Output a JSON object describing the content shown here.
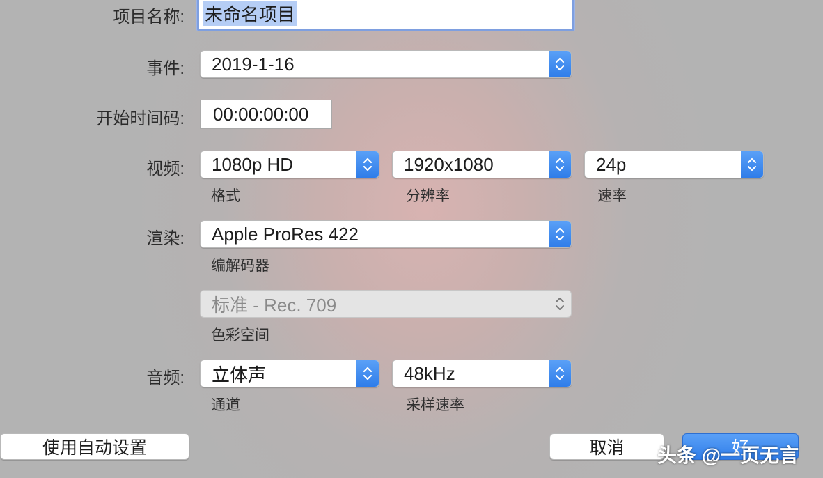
{
  "project_name": {
    "label": "项目名称:",
    "value": "未命名项目"
  },
  "event": {
    "label": "事件:",
    "value": "2019-1-16"
  },
  "timecode": {
    "label": "开始时间码:",
    "value": "00:00:00:00"
  },
  "video": {
    "label": "视频:",
    "format": {
      "value": "1080p HD",
      "caption": "格式"
    },
    "resolution": {
      "value": "1920x1080",
      "caption": "分辨率"
    },
    "rate": {
      "value": "24p",
      "caption": "速率"
    }
  },
  "render": {
    "label": "渲染:",
    "codec": {
      "value": "Apple ProRes 422",
      "caption": "编解码器"
    },
    "color_space": {
      "value": "标准 - Rec. 709",
      "caption": "色彩空间"
    }
  },
  "audio": {
    "label": "音频:",
    "channels": {
      "value": "立体声",
      "caption": "通道"
    },
    "sample_rate": {
      "value": "48kHz",
      "caption": "采样速率"
    }
  },
  "buttons": {
    "auto": "使用自动设置",
    "cancel": "取消",
    "ok": "好"
  },
  "watermark": "头条 @一页无言",
  "colors": {
    "accent": "#3b86ef",
    "selection": "#b5cdf5"
  }
}
